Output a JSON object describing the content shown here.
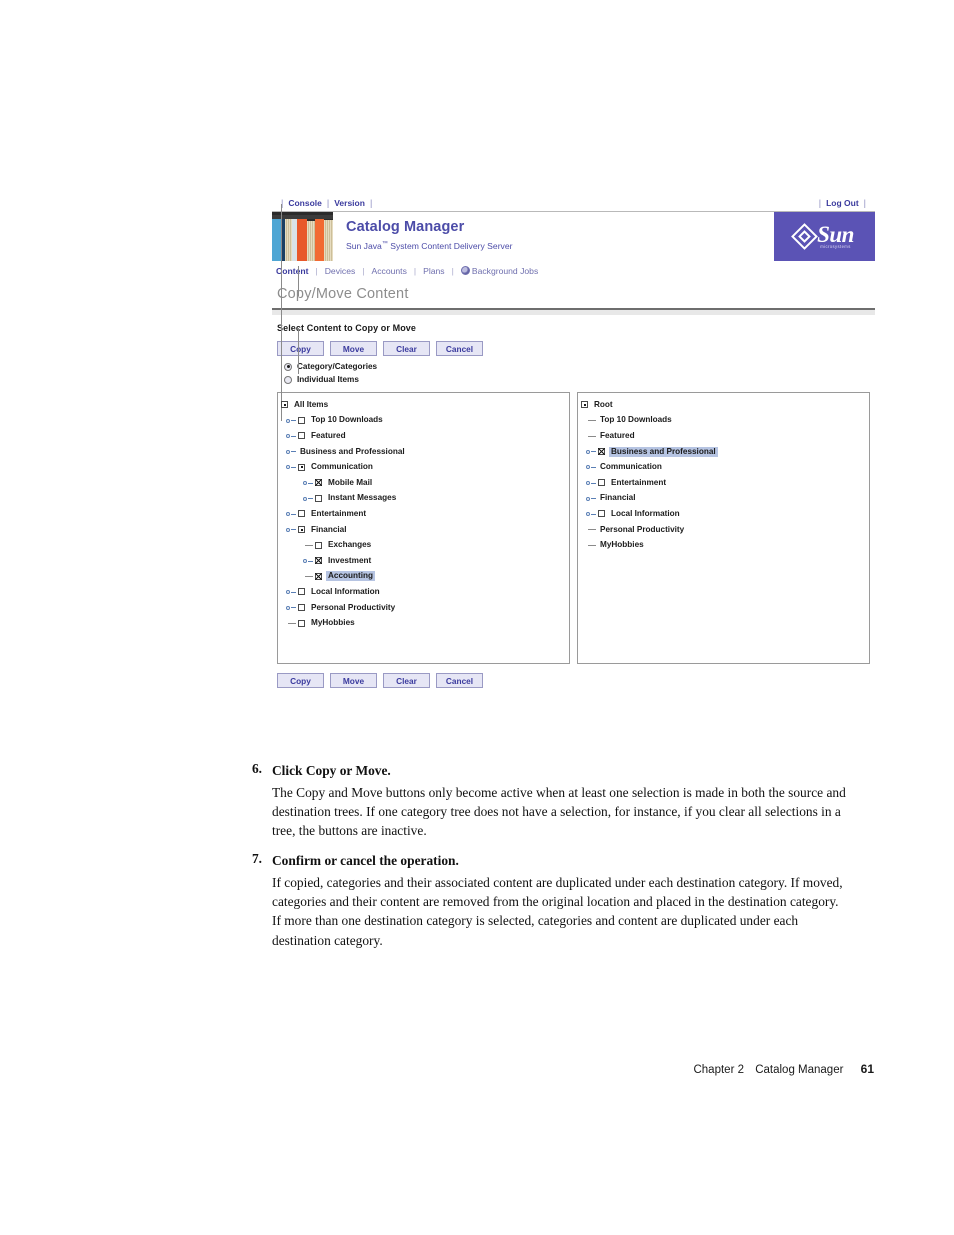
{
  "app": {
    "utility_bar": {
      "links": [
        "Console",
        "Version"
      ],
      "logout": "Log Out"
    },
    "masthead": {
      "title": "Catalog Manager",
      "subtitle_pre": "Sun Java",
      "subtitle_tm": "™",
      "subtitle_post": " System Content Delivery Server",
      "logo_text": "Sun",
      "logo_tagline": "microsystems",
      "logo_bg": "#5b53b5"
    },
    "tabs": [
      {
        "label": "Content",
        "active": true
      },
      {
        "label": "Devices",
        "active": false
      },
      {
        "label": "Accounts",
        "active": false
      },
      {
        "label": "Plans",
        "active": false
      },
      {
        "label": "Background Jobs",
        "active": false,
        "icon": "globe-icon"
      }
    ],
    "page_title": "Copy/Move Content",
    "section_heading": "Select Content to Copy or Move",
    "buttons_top": [
      "Copy",
      "Move",
      "Clear",
      "Cancel"
    ],
    "buttons_bottom": [
      "Copy",
      "Move",
      "Clear",
      "Cancel"
    ],
    "radios": [
      {
        "label": "Category/Categories",
        "checked": true
      },
      {
        "label": "Individual Items",
        "checked": false
      }
    ],
    "source_tree": {
      "name": "source-category-tree",
      "nodes": [
        {
          "label": "All Items",
          "depth": 0,
          "handle": "none",
          "box": "root",
          "selected": false
        },
        {
          "label": "Top 10 Downloads",
          "depth": 1,
          "handle": "expand",
          "box": "unchecked",
          "selected": false
        },
        {
          "label": "Featured",
          "depth": 1,
          "handle": "expand",
          "box": "unchecked",
          "selected": false
        },
        {
          "label": "Business and Professional",
          "depth": 1,
          "handle": "expand",
          "box": "none",
          "selected": false
        },
        {
          "label": "Communication",
          "depth": 1,
          "handle": "expand",
          "box": "root",
          "selected": false
        },
        {
          "label": "Mobile Mail",
          "depth": 2,
          "handle": "expand",
          "box": "checked",
          "selected": false
        },
        {
          "label": "Instant Messages",
          "depth": 2,
          "handle": "expand",
          "box": "unchecked",
          "selected": false
        },
        {
          "label": "Entertainment",
          "depth": 1,
          "handle": "expand",
          "box": "unchecked",
          "selected": false
        },
        {
          "label": "Financial",
          "depth": 1,
          "handle": "expand",
          "box": "root",
          "selected": false
        },
        {
          "label": "Exchanges",
          "depth": 2,
          "handle": "leaf",
          "box": "unchecked",
          "selected": false
        },
        {
          "label": "Investment",
          "depth": 2,
          "handle": "expand",
          "box": "checked",
          "selected": false
        },
        {
          "label": "Accounting",
          "depth": 2,
          "handle": "leaf",
          "box": "checked",
          "selected": true
        },
        {
          "label": "Local Information",
          "depth": 1,
          "handle": "expand",
          "box": "unchecked",
          "selected": false
        },
        {
          "label": "Personal Productivity",
          "depth": 1,
          "handle": "expand",
          "box": "unchecked",
          "selected": false
        },
        {
          "label": "MyHobbies",
          "depth": 1,
          "handle": "leaf",
          "box": "unchecked",
          "selected": false
        }
      ]
    },
    "destination_tree": {
      "name": "destination-category-tree",
      "nodes": [
        {
          "label": "All Items",
          "depth": 0,
          "handle": "none",
          "box": "root",
          "selected": false,
          "override_label": "Root"
        },
        {
          "label": "Top 10 Downloads",
          "depth": 1,
          "handle": "leaf",
          "box": "none",
          "selected": false
        },
        {
          "label": "Featured",
          "depth": 1,
          "handle": "leaf",
          "box": "none",
          "selected": false
        },
        {
          "label": "Business and Professional",
          "depth": 1,
          "handle": "expand",
          "box": "checked",
          "selected": true
        },
        {
          "label": "Communication",
          "depth": 1,
          "handle": "expand",
          "box": "none",
          "selected": false
        },
        {
          "label": "Entertainment",
          "depth": 1,
          "handle": "expand",
          "box": "unchecked",
          "selected": false
        },
        {
          "label": "Financial",
          "depth": 1,
          "handle": "expand",
          "box": "none",
          "selected": false
        },
        {
          "label": "Local Information",
          "depth": 1,
          "handle": "expand",
          "box": "unchecked",
          "selected": false
        },
        {
          "label": "Personal Productivity",
          "depth": 1,
          "handle": "leaf",
          "box": "none",
          "selected": false
        },
        {
          "label": "MyHobbies",
          "depth": 1,
          "handle": "leaf",
          "box": "none",
          "selected": false
        }
      ]
    }
  },
  "document": {
    "steps": [
      {
        "number": "6.",
        "heading": "Click Copy or Move.",
        "body": "The Copy and Move buttons only become active when at least one selection is made in both the source and destination trees. If one category tree does not have a selection, for instance, if you clear all selections in a tree, the buttons are inactive."
      },
      {
        "number": "7.",
        "heading": "Confirm or cancel the operation.",
        "body": "If copied, categories and their associated content are duplicated under each destination category. If moved, categories and their content are removed from the original location and placed in the destination category. If more than one destination category is selected, categories and content are duplicated under each destination category."
      }
    ],
    "footer": {
      "chapter": "Chapter 2",
      "title": "Catalog Manager",
      "page": "61"
    }
  }
}
